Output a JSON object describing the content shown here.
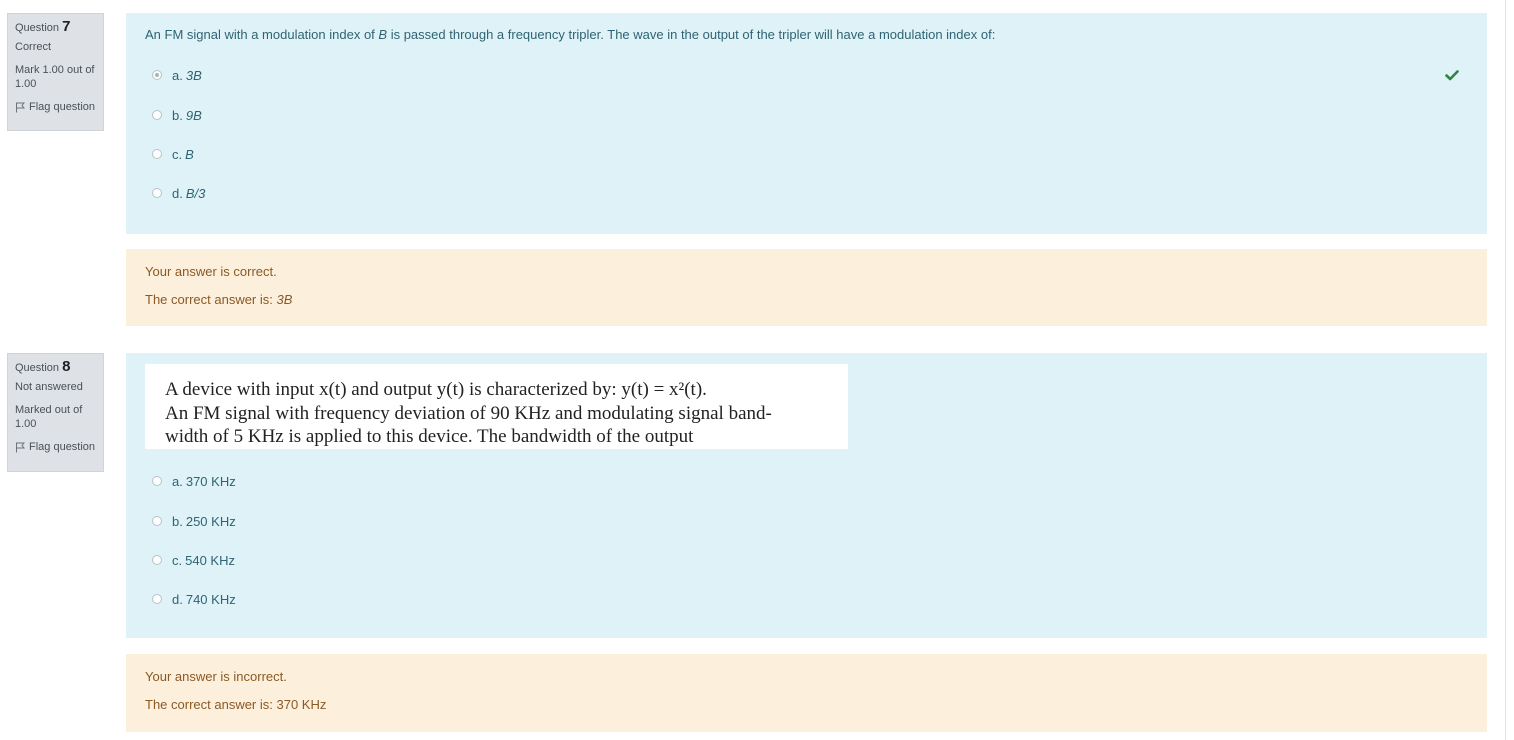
{
  "q7": {
    "info": {
      "label": "Question",
      "number": "7",
      "state": "Correct",
      "grade": "Mark 1.00 out of 1.00",
      "flag": "Flag question"
    },
    "text_before": "An FM signal with a modulation index of ",
    "text_var": "B",
    "text_after": " is passed through a frequency tripler. The wave in the output of the tripler will have a modulation index of:",
    "options": [
      {
        "letter": "a.",
        "value": "3B",
        "checked": true
      },
      {
        "letter": "b.",
        "value": "9B",
        "checked": false
      },
      {
        "letter": "c.",
        "value": "B",
        "checked": false
      },
      {
        "letter": "d.",
        "value": "B/3",
        "checked": false
      }
    ],
    "correct_icon": "check-icon",
    "feedback": {
      "result": "Your answer is correct.",
      "correct_prefix": "The correct answer is: ",
      "correct_value": "3B"
    }
  },
  "q8": {
    "info": {
      "label": "Question",
      "number": "8",
      "state": "Not answered",
      "grade": "Marked out of 1.00",
      "flag": "Flag question"
    },
    "image_text": {
      "line1": "A device with input x(t) and output y(t) is characterized by: y(t) = x²(t).",
      "line2": "An FM signal with frequency deviation of 90 KHz and modulating signal band-",
      "line3": "width of 5 KHz is applied to this device. The bandwidth of the output"
    },
    "options": [
      {
        "letter": "a.",
        "value": "370 KHz",
        "checked": false
      },
      {
        "letter": "b.",
        "value": "250 KHz",
        "checked": false
      },
      {
        "letter": "c.",
        "value": "540 KHz",
        "checked": false
      },
      {
        "letter": "d.",
        "value": "740 KHz",
        "checked": false
      }
    ],
    "feedback": {
      "result": "Your answer is incorrect.",
      "correct_prefix": "The correct answer is: ",
      "correct_value": "370 KHz"
    }
  },
  "colors": {
    "info_bg": "#dee2e6",
    "formulation_bg": "#def2f8",
    "formulation_text": "#2f6473",
    "feedback_bg": "#fcefdc",
    "feedback_text": "#8a5a25",
    "correct_check": "#2e8540"
  }
}
